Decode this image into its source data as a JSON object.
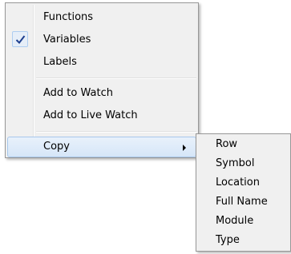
{
  "main_menu": {
    "items": [
      {
        "label": "Functions",
        "checked": false
      },
      {
        "label": "Variables",
        "checked": true
      },
      {
        "label": "Labels",
        "checked": false
      },
      {
        "label": "Add to Watch",
        "checked": false
      },
      {
        "label": "Add to Live Watch",
        "checked": false
      },
      {
        "label": "Copy",
        "has_submenu": true,
        "highlighted": true
      }
    ]
  },
  "copy_submenu": {
    "items": [
      {
        "label": "Row"
      },
      {
        "label": "Symbol"
      },
      {
        "label": "Location"
      },
      {
        "label": "Full Name"
      },
      {
        "label": "Module"
      },
      {
        "label": "Type"
      }
    ]
  },
  "icons": {
    "check": "checkmark-icon",
    "submenu_arrow": "chevron-right-icon"
  },
  "colors": {
    "menu_background": "#f0f0f0",
    "highlight_border": "#a8c8ec",
    "checkmark": "#1e3f8f"
  }
}
